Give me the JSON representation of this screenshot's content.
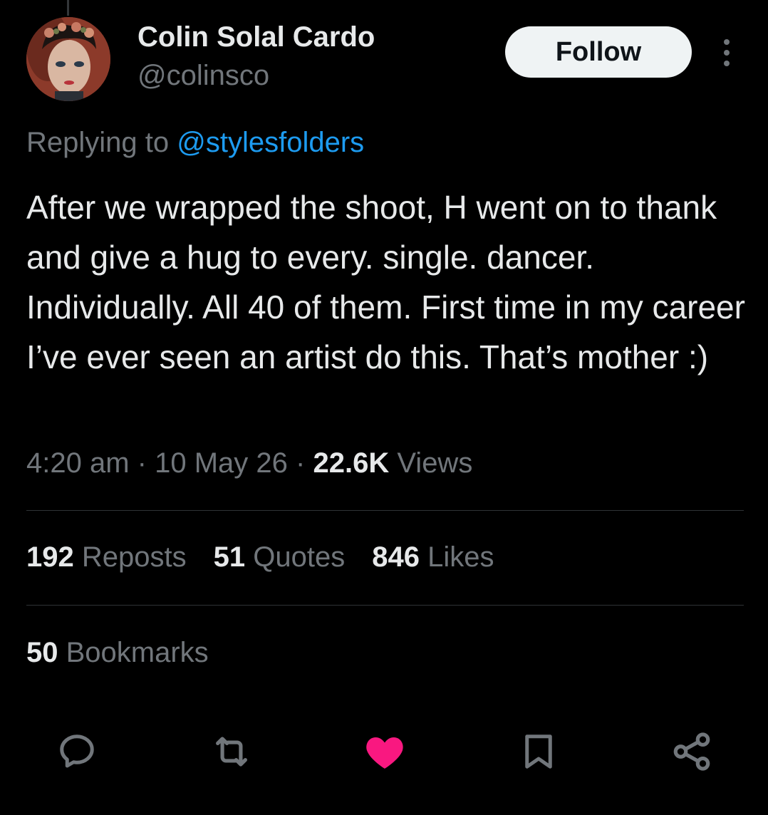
{
  "author": {
    "display_name": "Colin Solal Cardo",
    "handle": "@colinsco",
    "follow_label": "Follow"
  },
  "reply": {
    "prefix": "Replying to ",
    "mention": "@stylesfolders"
  },
  "tweet": {
    "text": "After we wrapped the shoot, H went on to thank and give a hug to every. single. dancer. Individually. All 40 of them. First time in my career I’ve ever seen an artist do this. That’s mother :)"
  },
  "meta": {
    "time": "4:20 am",
    "separator": "·",
    "date": "10 May 26",
    "views_count": "22.6K",
    "views_label": "Views"
  },
  "stats": {
    "reposts_count": "192",
    "reposts_label": "Reposts",
    "quotes_count": "51",
    "quotes_label": "Quotes",
    "likes_count": "846",
    "likes_label": "Likes",
    "bookmarks_count": "50",
    "bookmarks_label": "Bookmarks"
  },
  "actions": [
    {
      "icon": "reply-icon"
    },
    {
      "icon": "repost-icon"
    },
    {
      "icon": "like-icon",
      "active": true,
      "color": "#f91880"
    },
    {
      "icon": "bookmark-icon"
    },
    {
      "icon": "share-icon"
    }
  ],
  "colors": {
    "background": "#000000",
    "primary_text": "#e7e9ea",
    "secondary_text": "#71767b",
    "accent": "#1d9bf0",
    "like": "#f91880"
  }
}
